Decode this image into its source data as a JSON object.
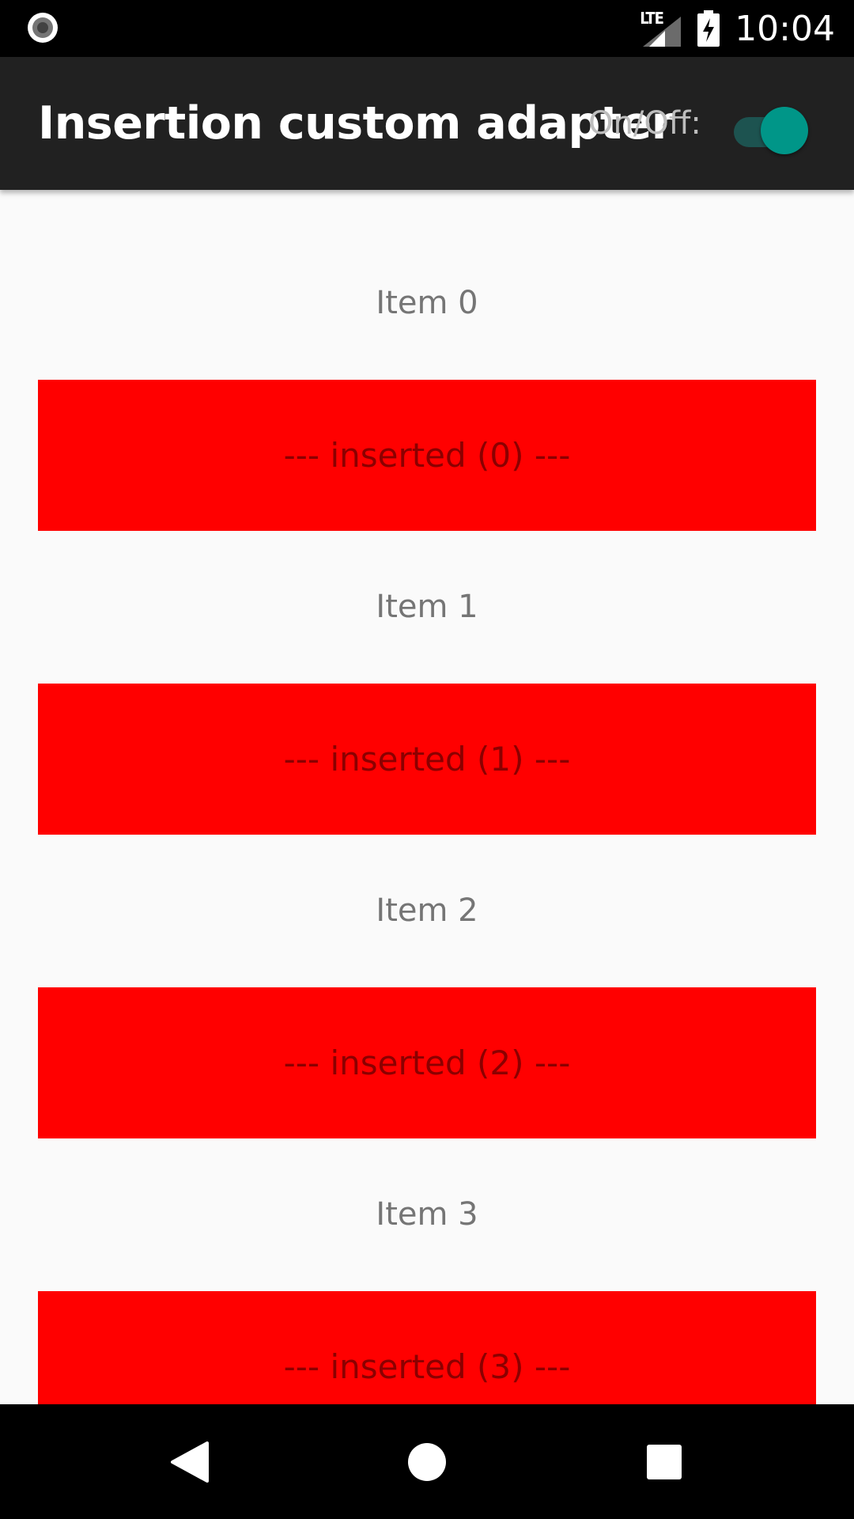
{
  "status_bar": {
    "network_label": "LTE",
    "time": "10:04",
    "icons": [
      "record-icon",
      "signal-icon",
      "battery-charging-icon"
    ]
  },
  "app_bar": {
    "title": "Insertion custom adapter",
    "switch_label": "On/Off:",
    "switch_on": true,
    "accent_color": "#009688",
    "background_color": "#212121"
  },
  "list": {
    "items": [
      {
        "label": "Item 0",
        "inserted": "--- inserted (0) ---"
      },
      {
        "label": "Item 1",
        "inserted": "--- inserted (1) ---"
      },
      {
        "label": "Item 2",
        "inserted": "--- inserted (2) ---"
      },
      {
        "label": "Item 3",
        "inserted": "--- inserted (3) ---"
      }
    ],
    "inserted_color": "#ff0000",
    "inserted_text_color": "#8b0000"
  },
  "nav_bar": {
    "icons": [
      "back-icon",
      "home-icon",
      "recents-icon"
    ]
  }
}
